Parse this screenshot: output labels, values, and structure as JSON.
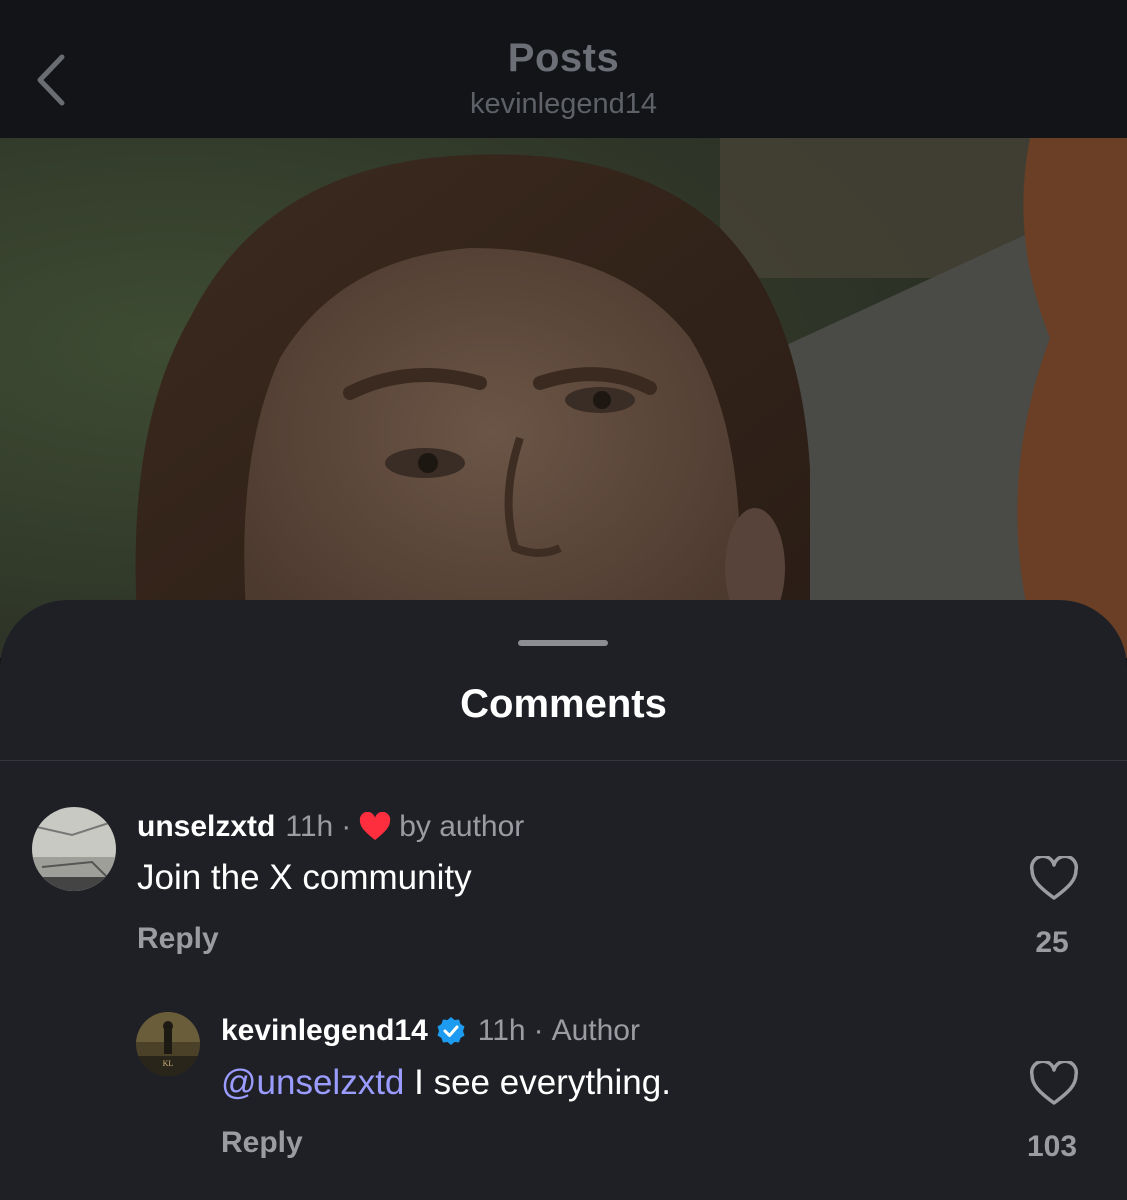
{
  "header": {
    "title": "Posts",
    "subtitle": "kevinlegend14",
    "back_icon": "chevron-left-icon"
  },
  "post": {
    "image_description_icon": "photo"
  },
  "sheet": {
    "title": "Comments"
  },
  "comments": [
    {
      "username": "unselzxtd",
      "time": "11h",
      "separator": "·",
      "liked_by_author_label": "by author",
      "text": "Join the X community",
      "reply_label": "Reply",
      "like_count": "25"
    },
    {
      "username": "kevinlegend14",
      "verified": true,
      "time": "11h",
      "separator": "·",
      "role": "Author",
      "mention": "@unselzxtd",
      "text": " I see everything.",
      "reply_label": "Reply",
      "like_count": "103"
    }
  ],
  "colors": {
    "accent_mention": "#9b9cff",
    "verified_blue": "#1d9bf0",
    "heart_red": "#ff2e3e"
  }
}
